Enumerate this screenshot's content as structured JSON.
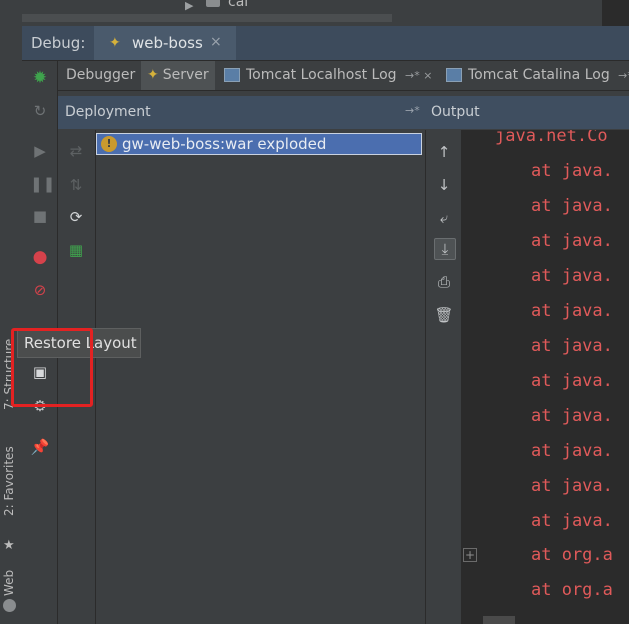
{
  "project_tree": {
    "item_label": "cal"
  },
  "left_stripe": {
    "structure": "7: Structure",
    "favorites": "2: Favorites",
    "web": "Web"
  },
  "debug_header": {
    "label": "Debug:",
    "tab_label": "web-boss",
    "close": "×"
  },
  "debug_tools": [
    "resume-icon",
    "rerun-icon",
    "step-icon",
    "pause-icon",
    "stop-icon",
    "breakpoints-icon",
    "mute-icon",
    "restore-layout-icon",
    "settings-icon",
    "pin-icon"
  ],
  "sub_tabs": [
    {
      "label": "Debugger"
    },
    {
      "label": "Server"
    },
    {
      "label": "Tomcat Localhost Log",
      "suffix": "→* ×"
    },
    {
      "label": "Tomcat Catalina Log",
      "suffix": "→*"
    }
  ],
  "panes": {
    "deployment": "Deployment",
    "output": "Output",
    "pin_glyph": "→*"
  },
  "deployment": {
    "item": "gw-web-boss:war exploded",
    "warning_glyph": "!"
  },
  "output_tools": [
    "up-arrow-icon",
    "down-arrow-icon",
    "soft-wrap-icon",
    "scroll-to-end-icon",
    "print-icon",
    "trash-icon"
  ],
  "console": {
    "first": "java.net.Co",
    "lines": [
      "at java.",
      "at java.",
      "at java.",
      "at java.",
      "at java.",
      "at java.",
      "at java.",
      "at java.",
      "at java.",
      "at java.",
      "at java.",
      "at org.a",
      "at org.a"
    ]
  },
  "tooltip": {
    "text": "Restore Layout"
  },
  "colors": {
    "console_error": "#e05a5a",
    "highlight": "#e32222",
    "selection": "#4b6eaf"
  }
}
